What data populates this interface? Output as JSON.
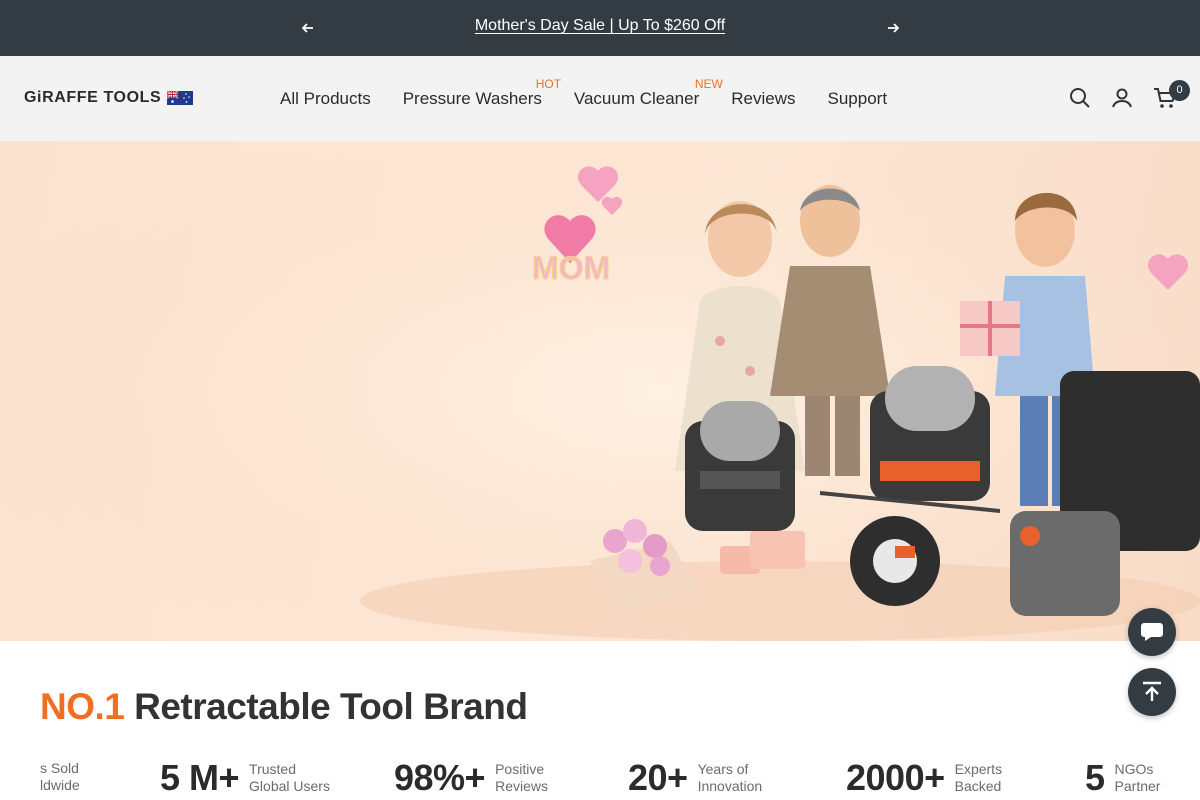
{
  "announcement": {
    "message": "Mother's Day Sale | Up To $260 Off",
    "prev_icon": "arrow-left-icon",
    "next_icon": "arrow-right-icon"
  },
  "header": {
    "logo_text": "GiRAFFE TOOLS",
    "flag": "australia-flag",
    "nav": [
      {
        "label": "All Products",
        "badge": ""
      },
      {
        "label": "Pressure Washers",
        "badge": "HOT"
      },
      {
        "label": "Vacuum Cleaner",
        "badge": "NEW"
      },
      {
        "label": "Reviews",
        "badge": ""
      },
      {
        "label": "Support",
        "badge": ""
      }
    ],
    "cart_count": "0"
  },
  "hero": {
    "balloon_text": "MOM"
  },
  "brand": {
    "accent": "NO.1",
    "title": " Retractable Tool Brand"
  },
  "stats": [
    {
      "num": "",
      "label1": "s Sold",
      "label2": "ldwide"
    },
    {
      "num": "5 M+",
      "label1": "Trusted",
      "label2": "Global Users"
    },
    {
      "num": "98%+",
      "label1": "Positive",
      "label2": "Reviews"
    },
    {
      "num": "20+",
      "label1": "Years of",
      "label2": "Innovation"
    },
    {
      "num": "2000+",
      "label1": "Experts",
      "label2": "Backed"
    },
    {
      "num": "5",
      "label1": "NGOs",
      "label2": "Partner"
    }
  ],
  "colors": {
    "accent": "#f26d21",
    "dark": "#333c42"
  }
}
